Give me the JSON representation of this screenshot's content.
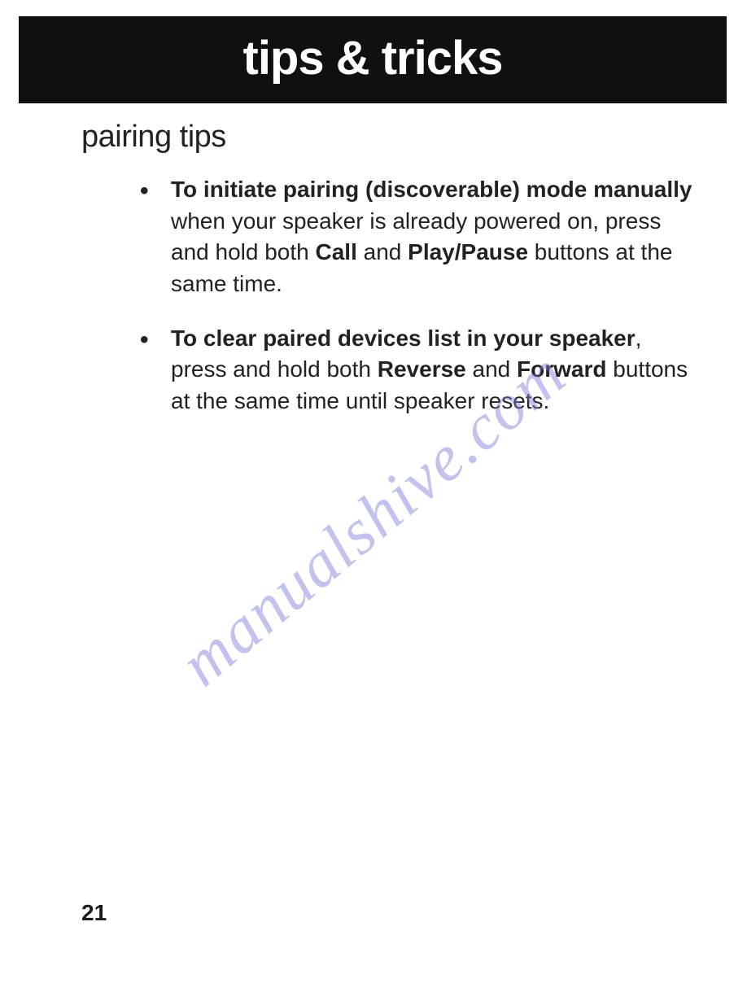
{
  "header": {
    "title": "tips & tricks"
  },
  "subheading": "pairing tips",
  "bullets": [
    {
      "bold_lead": "To initiate pairing (discoverable) mode manually",
      "text_after_lead": " when your speaker is already powered on, press and hold both ",
      "bold_1": "Call",
      "mid_1": " and ",
      "bold_2": "Play/Pause",
      "text_end": " buttons at the same time."
    },
    {
      "bold_lead": "To clear paired devices list in your speaker",
      "text_after_lead": ", press and hold both ",
      "bold_1": "Reverse",
      "mid_1": " and ",
      "bold_2": "Forward",
      "text_end": " buttons at the same time until speaker resets."
    }
  ],
  "page_number": "21",
  "watermark": "manualshive.com"
}
